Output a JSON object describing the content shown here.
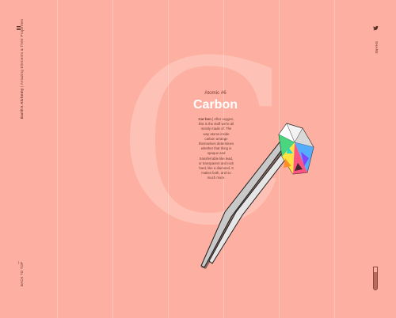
{
  "left_rail": {
    "title_bold": "Earth's Alchemy",
    "title_rest": " | Amazing Elements & Their Properties",
    "back_to_top": "BACK TO TOP"
  },
  "right_rail": {
    "share": "SHARE"
  },
  "hero": {
    "big_letter": "C",
    "atomic": "Atomic #6",
    "name": "Carbon",
    "desc_bold": "Car·bon",
    "desc_text": " | After oxygen, this is the stuff we're all mostly made of. The way atoms inside carbon arrange themselves determines whether that thing is opaque and transferrable like lead, or transparent and rock hard, like a diamond. It makes both, and so much more."
  },
  "icons": [
    "menu-icon",
    "arrow-up-icon",
    "twitter-icon",
    "test-tube-icon"
  ]
}
